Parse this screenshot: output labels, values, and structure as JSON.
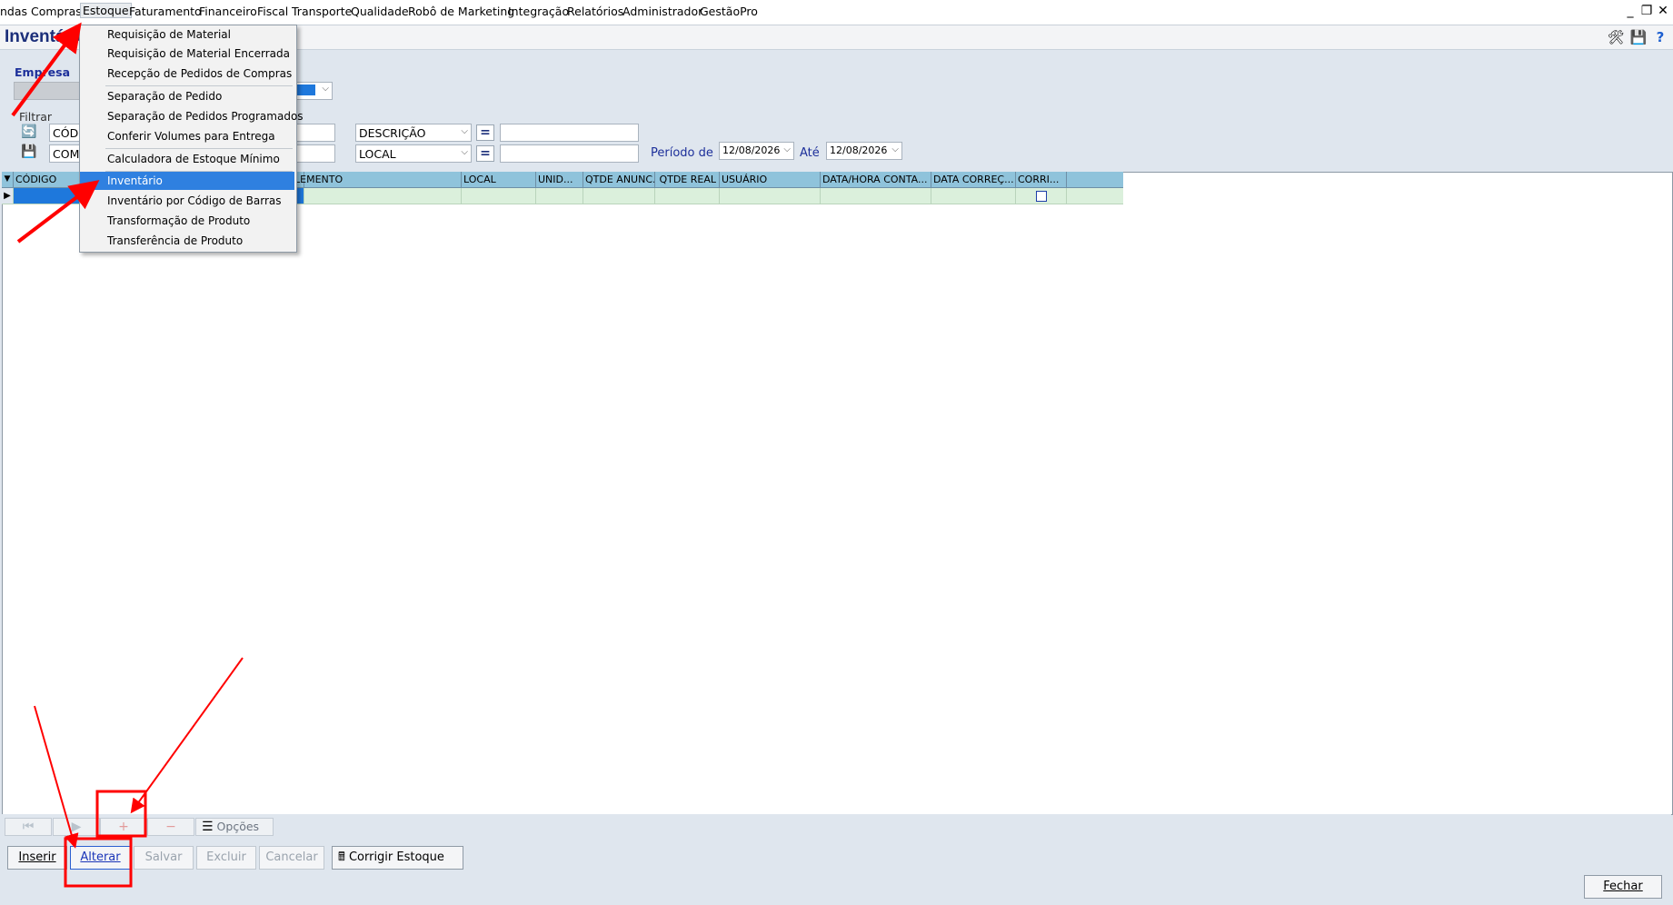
{
  "menubar": {
    "items": [
      "ndas",
      "Compras",
      "Estoque",
      "Faturamento",
      "Financeiro",
      "Fiscal",
      "Transporte",
      "Qualidade",
      "Robô de Marketing",
      "Integração",
      "Relatórios",
      "Administrador",
      "GestãoPro"
    ],
    "active": "Estoque",
    "window_controls": [
      "minimize",
      "restore",
      "close"
    ]
  },
  "titlebar": {
    "title": "Inventário",
    "icons": [
      "tools-icon",
      "save-icon",
      "help-icon"
    ]
  },
  "form": {
    "empresa_label": "Empresa",
    "filtrar_label": "Filtrar",
    "filter_rows": [
      {
        "field": "CÓD",
        "operator_field": "DESCRIÇÃO",
        "operator": "=",
        "value": ""
      },
      {
        "field": "COM",
        "operator_field": "LOCAL",
        "operator": "=",
        "value": ""
      }
    ],
    "periodo_label": "Período de",
    "periodo_de": "12/08/2026",
    "ate_label": "Até",
    "periodo_ate": "12/08/2026"
  },
  "grid": {
    "columns": [
      "CÓDIGO",
      "LEMENTO",
      "LOCAL",
      "UNID...",
      "QTDE ANUNC.",
      "QTDE REAL",
      "USUÁRIO",
      "DATA/HORA CONTA...",
      "DATA CORREÇ...",
      "CORRI..."
    ],
    "rows": [
      [
        "",
        "",
        "",
        "",
        "",
        "",
        "",
        "",
        "",
        ""
      ]
    ]
  },
  "dropdown": {
    "items": [
      "Requisição de Material",
      "Requisição de Material Encerrada",
      "Recepção de Pedidos de Compras",
      "Separação de Pedido",
      "Separação de Pedidos Programados",
      "Conferir Volumes para Entrega",
      "Calculadora de Estoque Mínimo",
      "Inventário",
      "Inventário por Código de Barras",
      "Transformação de Produto",
      "Transferência de Produto"
    ],
    "highlighted": "Inventário"
  },
  "navbar": {
    "buttons": [
      "first",
      "next",
      "add",
      "remove"
    ],
    "opcoes_label": "Opções"
  },
  "actions": {
    "inserir": "Inserir",
    "alterar": "Alterar",
    "salvar": "Salvar",
    "excluir": "Excluir",
    "cancelar": "Cancelar",
    "corrigir": "Corrigir Estoque",
    "fechar": "Fechar"
  },
  "colors": {
    "annotation": "#ff0000",
    "grid_header": "#8fc3db",
    "row_bg": "#dbf0dc",
    "highlight": "#2f80e0"
  }
}
